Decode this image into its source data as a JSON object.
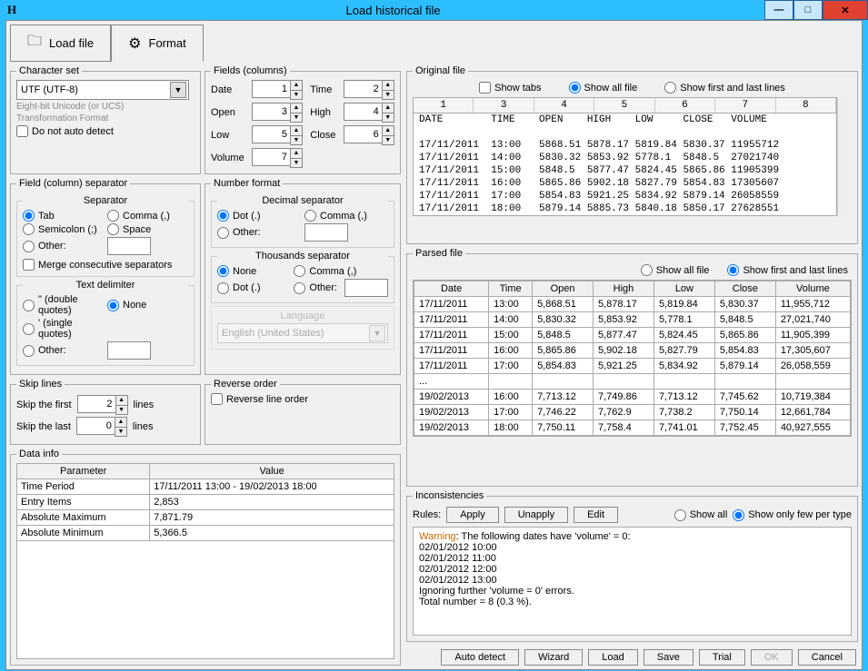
{
  "window": {
    "app_glyph": "H",
    "title": "Load historical file"
  },
  "tabs": {
    "load_file": "Load file",
    "format": "Format"
  },
  "charset": {
    "legend": "Character set",
    "value": "UTF (UTF-8)",
    "hint1": "Eight-bit Unicode (or UCS)",
    "hint2": "Transformation Format",
    "no_auto": "Do not auto detect"
  },
  "fields": {
    "legend": "Fields (columns)",
    "date": "Date",
    "date_v": "1",
    "time": "Time",
    "time_v": "2",
    "open": "Open",
    "open_v": "3",
    "high": "High",
    "high_v": "4",
    "low": "Low",
    "low_v": "5",
    "close": "Close",
    "close_v": "6",
    "volume": "Volume",
    "volume_v": "7"
  },
  "separator": {
    "legend": "Field (column) separator",
    "sep_title": "Separator",
    "tab": "Tab",
    "comma": "Comma (,)",
    "semicolon": "Semicolon (;)",
    "space": "Space",
    "other": "Other:",
    "merge": "Merge consecutive separators",
    "delim_title": "Text delimiter",
    "dq": "\" (double quotes)",
    "none": "None",
    "sq": "' (single quotes)"
  },
  "numfmt": {
    "legend": "Number format",
    "dec_title": "Decimal separator",
    "dot": "Dot (.)",
    "comma": "Comma (,)",
    "other": "Other:",
    "thou_title": "Thousands separator",
    "none": "None",
    "lang_title": "Language",
    "lang_value": "English (United States)"
  },
  "skip": {
    "legend": "Skip lines",
    "first": "Skip the first",
    "first_v": "2",
    "last": "Skip the last",
    "last_v": "0",
    "lines": "lines"
  },
  "reverse": {
    "legend": "Reverse order",
    "label": "Reverse line order"
  },
  "datainfo": {
    "legend": "Data info",
    "h_param": "Parameter",
    "h_val": "Value",
    "rows": [
      {
        "p": "Time Period",
        "v": "17/11/2011 13:00 - 19/02/2013 18:00"
      },
      {
        "p": "Entry Items",
        "v": "2,853"
      },
      {
        "p": "Absolute Maximum",
        "v": "7,871.79"
      },
      {
        "p": "Absolute Minimum",
        "v": "5,366.5"
      }
    ]
  },
  "orig": {
    "legend": "Original file",
    "show_tabs": "Show tabs",
    "show_all": "Show all file",
    "show_fl": "Show first and last lines",
    "cols": [
      "1",
      "3",
      "4",
      "5",
      "6",
      "7",
      "8"
    ],
    "header_line": "DATE        TIME    OPEN    HIGH    LOW     CLOSE   VOLUME",
    "rows": [
      "17/11/2011  13:00   5868.51 5878.17 5819.84 5830.37 11955712",
      "17/11/2011  14:00   5830.32 5853.92 5778.1  5848.5  27021740",
      "17/11/2011  15:00   5848.5  5877.47 5824.45 5865.86 11905399",
      "17/11/2011  16:00   5865.86 5902.18 5827.79 5854.83 17305607",
      "17/11/2011  17:00   5854.83 5921.25 5834.92 5879.14 26058559",
      "17/11/2011  18:00   5879.14 5885.73 5840.18 5850.17 27628551"
    ]
  },
  "parsed": {
    "legend": "Parsed file",
    "show_all": "Show all file",
    "show_fl": "Show first and last lines",
    "headers": [
      "Date",
      "Time",
      "Open",
      "High",
      "Low",
      "Close",
      "Volume"
    ],
    "rows": [
      [
        "17/11/2011",
        "13:00",
        "5,868.51",
        "5,878.17",
        "5,819.84",
        "5,830.37",
        "11,955,712"
      ],
      [
        "17/11/2011",
        "14:00",
        "5,830.32",
        "5,853.92",
        "5,778.1",
        "5,848.5",
        "27,021,740"
      ],
      [
        "17/11/2011",
        "15:00",
        "5,848.5",
        "5,877.47",
        "5,824.45",
        "5,865.86",
        "11,905,399"
      ],
      [
        "17/11/2011",
        "16:00",
        "5,865.86",
        "5,902.18",
        "5,827.79",
        "5,854.83",
        "17,305,607"
      ],
      [
        "17/11/2011",
        "17:00",
        "5,854.83",
        "5,921.25",
        "5,834.92",
        "5,879.14",
        "26,058,559"
      ],
      [
        "...",
        "",
        "",
        "",
        "",
        "",
        ""
      ],
      [
        "19/02/2013",
        "16:00",
        "7,713.12",
        "7,749.86",
        "7,713.12",
        "7,745.62",
        "10,719,384"
      ],
      [
        "19/02/2013",
        "17:00",
        "7,746.22",
        "7,762.9",
        "7,738.2",
        "7,750.14",
        "12,661,784"
      ],
      [
        "19/02/2013",
        "18:00",
        "7,750.11",
        "7,758.4",
        "7,741.01",
        "7,752.45",
        "40,927,555"
      ]
    ]
  },
  "incons": {
    "legend": "Inconsistencies",
    "rules": "Rules:",
    "apply": "Apply",
    "unapply": "Unapply",
    "edit": "Edit",
    "show_all": "Show all",
    "show_few": "Show only few per type",
    "warn": "Warning",
    "warn_text": ": The following dates have 'volume' = 0:",
    "lines": [
      "02/01/2012 10:00",
      "02/01/2012 11:00",
      "02/01/2012 12:00",
      "02/01/2012 13:00",
      "Ignoring further 'volume = 0' errors.",
      "Total number = 8 (0.3 %)."
    ]
  },
  "footer": {
    "auto": "Auto detect",
    "wizard": "Wizard",
    "load": "Load",
    "save": "Save",
    "trial": "Trial",
    "ok": "OK",
    "cancel": "Cancel"
  }
}
